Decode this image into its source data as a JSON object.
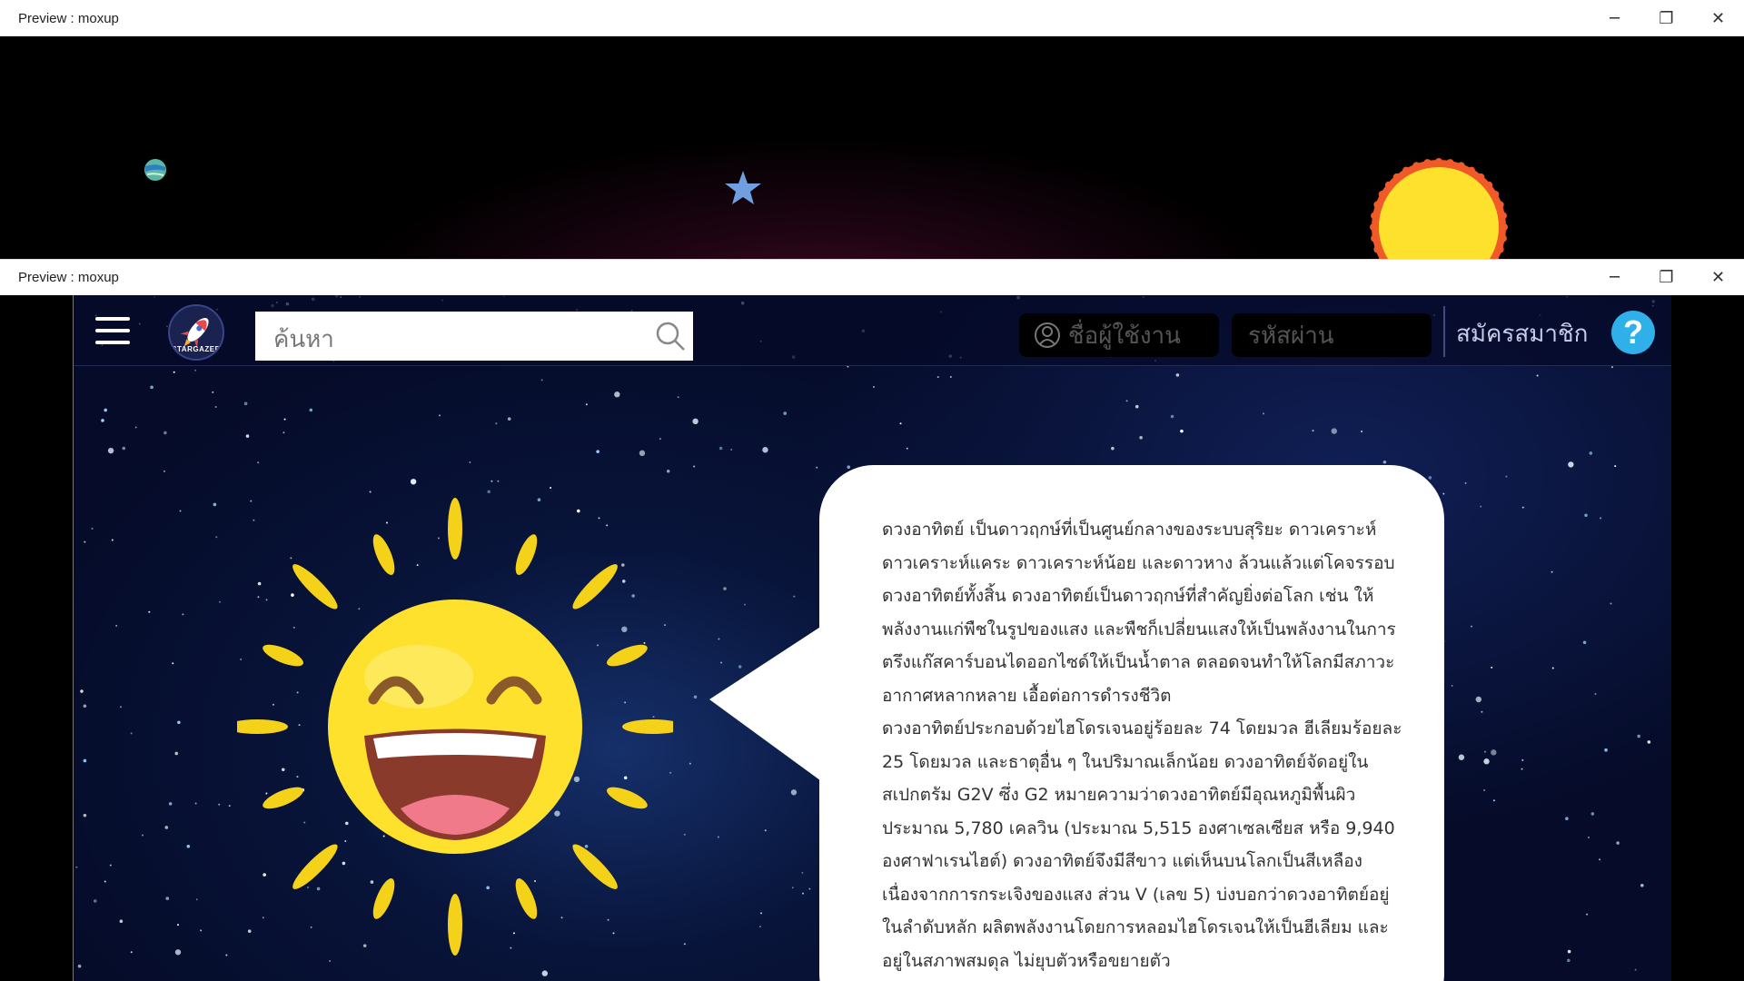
{
  "back_window": {
    "title": "Preview : moxup",
    "controls": [
      "minimize",
      "maximize",
      "close"
    ]
  },
  "front_window": {
    "title": "Preview : moxup",
    "controls": [
      "minimize",
      "maximize",
      "close"
    ]
  },
  "icons": {
    "minimize": "─",
    "maximize": "❐",
    "close": "✕"
  },
  "navbar": {
    "logo_text": "STARGAZER",
    "search_placeholder": "ค้นหา",
    "username_placeholder": "ชื่อผู้ใช้งาน",
    "password_placeholder": "รหัสผ่าน",
    "signup_label": "สมัครสมาชิก",
    "help_label": "?"
  },
  "content": {
    "paragraph_1": "ดวงอาทิตย์ เป็นดาวฤกษ์ที่เป็นศูนย์กลางของระบบสุริยะ ดาวเคราะห์ ดาวเคราะห์แคระ ดาวเคราะห์น้อย และดาวหาง ล้วนแล้วแต่โคจรรอบดวงอาทิตย์ทั้งสิ้น ดวงอาทิตย์เป็นดาวฤกษ์ที่สำคัญยิ่งต่อโลก เช่น ให้พลังงานแก่พืชในรูปของแสง และพืชก็เปลี่ยนแสงให้เป็นพลังงานในการตรึงแก๊สคาร์บอนไดออกไซด์ให้เป็นน้ำตาล ตลอดจนทำให้โลกมีสภาวะอากาศหลากหลาย เอื้อต่อการดำรงชีวิต",
    "paragraph_2": "ดวงอาทิตย์ประกอบด้วยไฮโดรเจนอยู่ร้อยละ 74 โดยมวล ฮีเลียมร้อยละ 25 โดยมวล และธาตุอื่น ๆ ในปริมาณเล็กน้อย ดวงอาทิตย์จัดอยู่ในสเปกตรัม G2V ซึ่ง G2 หมายความว่าดวงอาทิตย์มีอุณหภูมิพื้นผิวประมาณ 5,780 เคลวิน (ประมาณ 5,515 องศาเซลเซียส หรือ 9,940 องศาฟาเรนไฮต์) ดวงอาทิตย์จึงมีสีขาว แต่เห็นบนโลกเป็นสีเหลือง เนื่องจากการกระเจิงของแสง ส่วน V (เลข 5) บ่งบอกว่าดวงอาทิตย์อยู่ในลำดับหลัก ผลิตพลังงานโดยการหลอมไฮโดรเจนให้เป็นฮีเลียม และอยู่ในสภาพสมดุล ไม่ยุบตัวหรือขยายตัว"
  },
  "colors": {
    "help": "#2fb0e8",
    "sun": "#fde12d",
    "sun_rays": "#f5d21a",
    "space_bg": "#050b28"
  }
}
